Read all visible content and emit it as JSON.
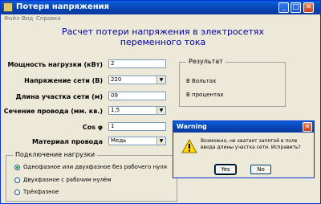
{
  "window": {
    "title": "Потеря напряжения",
    "minimize_glyph": "_",
    "maximize_glyph": "□",
    "close_glyph": "✕"
  },
  "menu": [
    "Файл",
    "Вид",
    "Справка"
  ],
  "heading": {
    "line1": "Расчет потери напряжения в электросетях",
    "line2": "переменного тока"
  },
  "form": {
    "load_power_label": "Мощность нагрузки (кВт)",
    "load_power_value": "2",
    "voltage_label": "Напряжение сети (В)",
    "voltage_value": "220",
    "length_label": "Длина участка сети (м)",
    "length_value": "09",
    "section_label": "Сечение провода (мм. кв.)",
    "section_value": "1,5",
    "cos_label": "Cos φ",
    "cos_value": "1",
    "material_label": "Материал провода",
    "material_value": "Медь"
  },
  "result": {
    "caption": "Результат",
    "volts": "В Вольтах",
    "percent": "В процентах"
  },
  "connection": {
    "caption": "Подключение нагрузки",
    "options": [
      "Однофазное или двухфазное без рабочего нуля",
      "Двухфазное с рабочим нулём",
      "Трёхфазное"
    ],
    "selected": 0
  },
  "dialog": {
    "title": "Warning",
    "message": "Возможно, не хватает запятой в поле ввода длины участка сети. Исправить?",
    "yes": "Yes",
    "no": "No",
    "icon": "warning-triangle"
  }
}
